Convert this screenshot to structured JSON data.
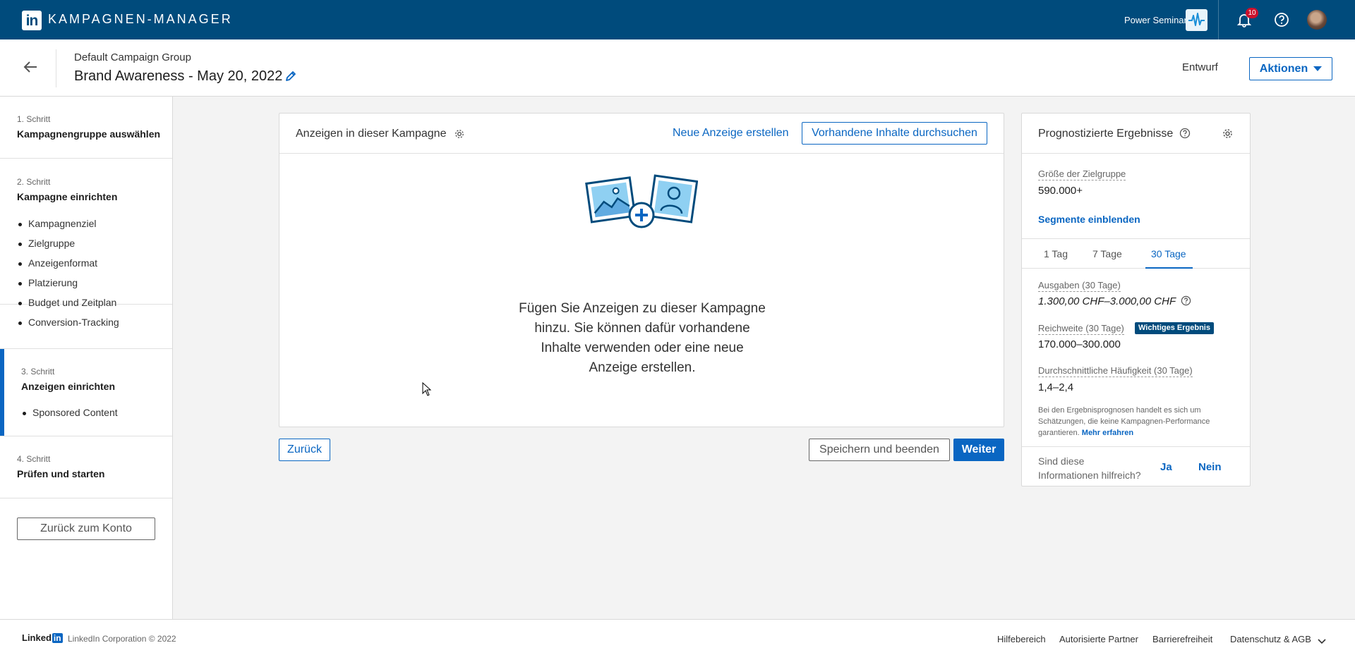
{
  "topbar": {
    "logo_text": "in",
    "title": "KAMPAGNEN-MANAGER",
    "account_name": "Power Seminar",
    "notifications_count": "10",
    "brand_color": "#004b7c"
  },
  "header": {
    "group_name": "Default Campaign Group",
    "campaign_name": "Brand Awareness - May 20, 2022",
    "status": "Entwurf",
    "actions_label": "Aktionen"
  },
  "sidebar": {
    "steps": [
      {
        "number": "1. Schritt",
        "title": "Kampagnengruppe auswählen",
        "items": []
      },
      {
        "number": "2. Schritt",
        "title": "Kampagne einrichten",
        "items": [
          "Kampagnenziel",
          "Zielgruppe",
          "Anzeigenformat",
          "Platzierung",
          "Budget und Zeitplan",
          "Conversion-Tracking"
        ]
      },
      {
        "number": "3. Schritt",
        "title": "Anzeigen einrichten",
        "items": [
          "Sponsored Content"
        ],
        "active": true
      },
      {
        "number": "4. Schritt",
        "title": "Prüfen und starten",
        "items": []
      }
    ],
    "back_to_account": "Zurück zum Konto"
  },
  "ads": {
    "title": "Anzeigen in dieser Kampagne",
    "new_ad_link": "Neue Anzeige erstellen",
    "browse_button": "Vorhandene Inhalte durchsuchen",
    "empty_message": "Fügen Sie Anzeigen zu dieser Kampagne hinzu. Sie können dafür vorhandene Inhalte verwenden oder eine neue Anzeige erstellen."
  },
  "nav_buttons": {
    "back": "Zurück",
    "save": "Speichern und beenden",
    "next": "Weiter"
  },
  "forecast": {
    "title": "Prognostizierte Ergebnisse",
    "audience_label": "Größe der Zielgruppe",
    "audience_value": "590.000+",
    "segments_link": "Segmente einblenden",
    "tabs": [
      "1 Tag",
      "7 Tage",
      "30 Tage"
    ],
    "active_tab": "30 Tage",
    "spend_label": "Ausgaben (30 Tage)",
    "spend_value": "1.300,00 CHF–3.000,00 CHF",
    "reach_label": "Reichweite (30 Tage)",
    "reach_badge": "Wichtiges Ergebnis",
    "reach_value": "170.000–300.000",
    "frequency_label": "Durchschnittliche Häufigkeit (30 Tage)",
    "frequency_value": "1,4–2,4",
    "note": "Bei den Ergebnisprognosen handelt es sich um Schätzungen, die keine Kampagnen-Performance garantieren.",
    "note_link": "Mehr erfahren",
    "feedback_question": "Sind diese Informationen hilfreich?",
    "feedback_yes": "Ja",
    "feedback_no": "Nein"
  },
  "footer": {
    "logo_text": "Linked",
    "logo_in": "in",
    "copyright": "LinkedIn Corporation © 2022",
    "links": [
      "Hilfebereich",
      "Autorisierte Partner",
      "Barrierefreiheit",
      "Datenschutz & AGB"
    ]
  }
}
